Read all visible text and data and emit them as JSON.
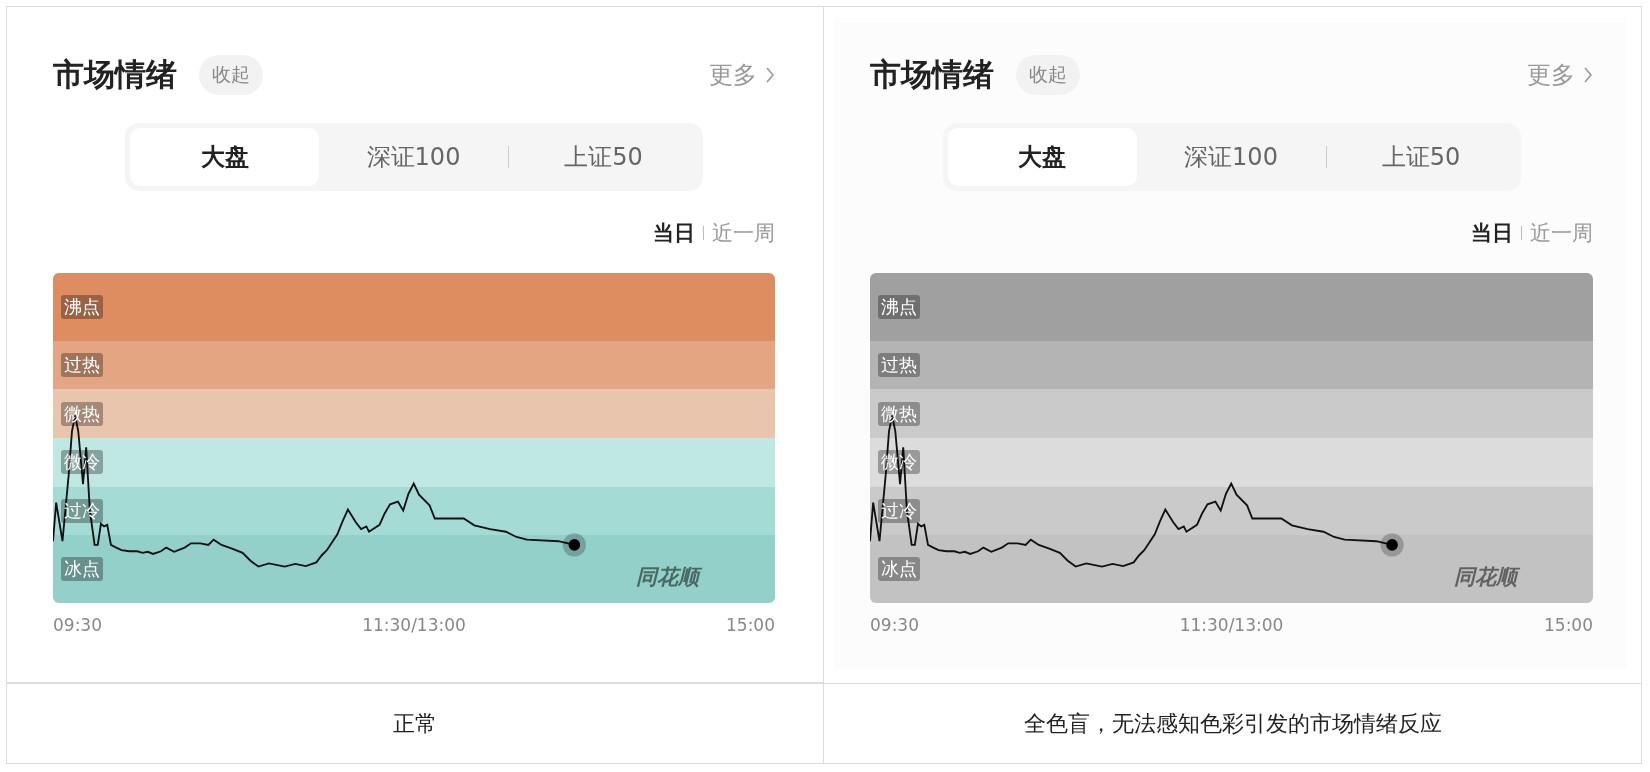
{
  "panels": [
    {
      "header": {
        "title": "市场情绪",
        "collapse": "收起",
        "more": "更多"
      },
      "tabs": [
        {
          "label": "大盘",
          "selected": true
        },
        {
          "label": "深证100",
          "selected": false
        },
        {
          "label": "上证50",
          "selected": false
        }
      ],
      "periods": [
        {
          "label": "当日",
          "selected": true
        },
        {
          "label": "近一周",
          "selected": false
        }
      ],
      "chart": {
        "bands": [
          {
            "label": "沸点",
            "color": "#dd8d60"
          },
          {
            "label": "过热",
            "color": "#e4a682"
          },
          {
            "label": "微热",
            "color": "#eac5ad"
          },
          {
            "label": "微冷",
            "color": "#c0e8e3"
          },
          {
            "label": "过冷",
            "color": "#a4dbd5"
          },
          {
            "label": "冰点",
            "color": "#92d0c9"
          }
        ],
        "watermark": "同花顺",
        "x_labels": [
          "09:30",
          "11:30/13:00",
          "15:00"
        ]
      },
      "caption": "正常"
    },
    {
      "header": {
        "title": "市场情绪",
        "collapse": "收起",
        "more": "更多"
      },
      "tabs": [
        {
          "label": "大盘",
          "selected": true
        },
        {
          "label": "深证100",
          "selected": false
        },
        {
          "label": "上证50",
          "selected": false
        }
      ],
      "periods": [
        {
          "label": "当日",
          "selected": true
        },
        {
          "label": "近一周",
          "selected": false
        }
      ],
      "chart": {
        "bands": [
          {
            "label": "沸点",
            "color": "#a0a0a0"
          },
          {
            "label": "过热",
            "color": "#b4b4b4"
          },
          {
            "label": "微热",
            "color": "#cacaca"
          },
          {
            "label": "微冷",
            "color": "#dcdcdc"
          },
          {
            "label": "过冷",
            "color": "#cacaca"
          },
          {
            "label": "冰点",
            "color": "#c2c2c2"
          }
        ],
        "watermark": "同花顺",
        "x_labels": [
          "09:30",
          "11:30/13:00",
          "15:00"
        ]
      },
      "caption": "全色盲，无法感知色彩引发的市场情绪反应"
    }
  ]
}
